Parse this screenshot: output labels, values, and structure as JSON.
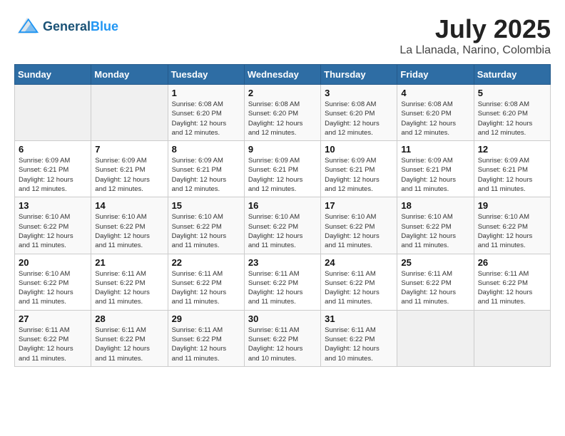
{
  "header": {
    "logo_line1": "General",
    "logo_line2": "Blue",
    "title": "July 2025",
    "subtitle": "La Llanada, Narino, Colombia"
  },
  "columns": [
    "Sunday",
    "Monday",
    "Tuesday",
    "Wednesday",
    "Thursday",
    "Friday",
    "Saturday"
  ],
  "weeks": [
    [
      {
        "day": "",
        "info": ""
      },
      {
        "day": "",
        "info": ""
      },
      {
        "day": "1",
        "info": "Sunrise: 6:08 AM\nSunset: 6:20 PM\nDaylight: 12 hours\nand 12 minutes."
      },
      {
        "day": "2",
        "info": "Sunrise: 6:08 AM\nSunset: 6:20 PM\nDaylight: 12 hours\nand 12 minutes."
      },
      {
        "day": "3",
        "info": "Sunrise: 6:08 AM\nSunset: 6:20 PM\nDaylight: 12 hours\nand 12 minutes."
      },
      {
        "day": "4",
        "info": "Sunrise: 6:08 AM\nSunset: 6:20 PM\nDaylight: 12 hours\nand 12 minutes."
      },
      {
        "day": "5",
        "info": "Sunrise: 6:08 AM\nSunset: 6:20 PM\nDaylight: 12 hours\nand 12 minutes."
      }
    ],
    [
      {
        "day": "6",
        "info": "Sunrise: 6:09 AM\nSunset: 6:21 PM\nDaylight: 12 hours\nand 12 minutes."
      },
      {
        "day": "7",
        "info": "Sunrise: 6:09 AM\nSunset: 6:21 PM\nDaylight: 12 hours\nand 12 minutes."
      },
      {
        "day": "8",
        "info": "Sunrise: 6:09 AM\nSunset: 6:21 PM\nDaylight: 12 hours\nand 12 minutes."
      },
      {
        "day": "9",
        "info": "Sunrise: 6:09 AM\nSunset: 6:21 PM\nDaylight: 12 hours\nand 12 minutes."
      },
      {
        "day": "10",
        "info": "Sunrise: 6:09 AM\nSunset: 6:21 PM\nDaylight: 12 hours\nand 12 minutes."
      },
      {
        "day": "11",
        "info": "Sunrise: 6:09 AM\nSunset: 6:21 PM\nDaylight: 12 hours\nand 11 minutes."
      },
      {
        "day": "12",
        "info": "Sunrise: 6:09 AM\nSunset: 6:21 PM\nDaylight: 12 hours\nand 11 minutes."
      }
    ],
    [
      {
        "day": "13",
        "info": "Sunrise: 6:10 AM\nSunset: 6:22 PM\nDaylight: 12 hours\nand 11 minutes."
      },
      {
        "day": "14",
        "info": "Sunrise: 6:10 AM\nSunset: 6:22 PM\nDaylight: 12 hours\nand 11 minutes."
      },
      {
        "day": "15",
        "info": "Sunrise: 6:10 AM\nSunset: 6:22 PM\nDaylight: 12 hours\nand 11 minutes."
      },
      {
        "day": "16",
        "info": "Sunrise: 6:10 AM\nSunset: 6:22 PM\nDaylight: 12 hours\nand 11 minutes."
      },
      {
        "day": "17",
        "info": "Sunrise: 6:10 AM\nSunset: 6:22 PM\nDaylight: 12 hours\nand 11 minutes."
      },
      {
        "day": "18",
        "info": "Sunrise: 6:10 AM\nSunset: 6:22 PM\nDaylight: 12 hours\nand 11 minutes."
      },
      {
        "day": "19",
        "info": "Sunrise: 6:10 AM\nSunset: 6:22 PM\nDaylight: 12 hours\nand 11 minutes."
      }
    ],
    [
      {
        "day": "20",
        "info": "Sunrise: 6:10 AM\nSunset: 6:22 PM\nDaylight: 12 hours\nand 11 minutes."
      },
      {
        "day": "21",
        "info": "Sunrise: 6:11 AM\nSunset: 6:22 PM\nDaylight: 12 hours\nand 11 minutes."
      },
      {
        "day": "22",
        "info": "Sunrise: 6:11 AM\nSunset: 6:22 PM\nDaylight: 12 hours\nand 11 minutes."
      },
      {
        "day": "23",
        "info": "Sunrise: 6:11 AM\nSunset: 6:22 PM\nDaylight: 12 hours\nand 11 minutes."
      },
      {
        "day": "24",
        "info": "Sunrise: 6:11 AM\nSunset: 6:22 PM\nDaylight: 12 hours\nand 11 minutes."
      },
      {
        "day": "25",
        "info": "Sunrise: 6:11 AM\nSunset: 6:22 PM\nDaylight: 12 hours\nand 11 minutes."
      },
      {
        "day": "26",
        "info": "Sunrise: 6:11 AM\nSunset: 6:22 PM\nDaylight: 12 hours\nand 11 minutes."
      }
    ],
    [
      {
        "day": "27",
        "info": "Sunrise: 6:11 AM\nSunset: 6:22 PM\nDaylight: 12 hours\nand 11 minutes."
      },
      {
        "day": "28",
        "info": "Sunrise: 6:11 AM\nSunset: 6:22 PM\nDaylight: 12 hours\nand 11 minutes."
      },
      {
        "day": "29",
        "info": "Sunrise: 6:11 AM\nSunset: 6:22 PM\nDaylight: 12 hours\nand 11 minutes."
      },
      {
        "day": "30",
        "info": "Sunrise: 6:11 AM\nSunset: 6:22 PM\nDaylight: 12 hours\nand 10 minutes."
      },
      {
        "day": "31",
        "info": "Sunrise: 6:11 AM\nSunset: 6:22 PM\nDaylight: 12 hours\nand 10 minutes."
      },
      {
        "day": "",
        "info": ""
      },
      {
        "day": "",
        "info": ""
      }
    ]
  ]
}
